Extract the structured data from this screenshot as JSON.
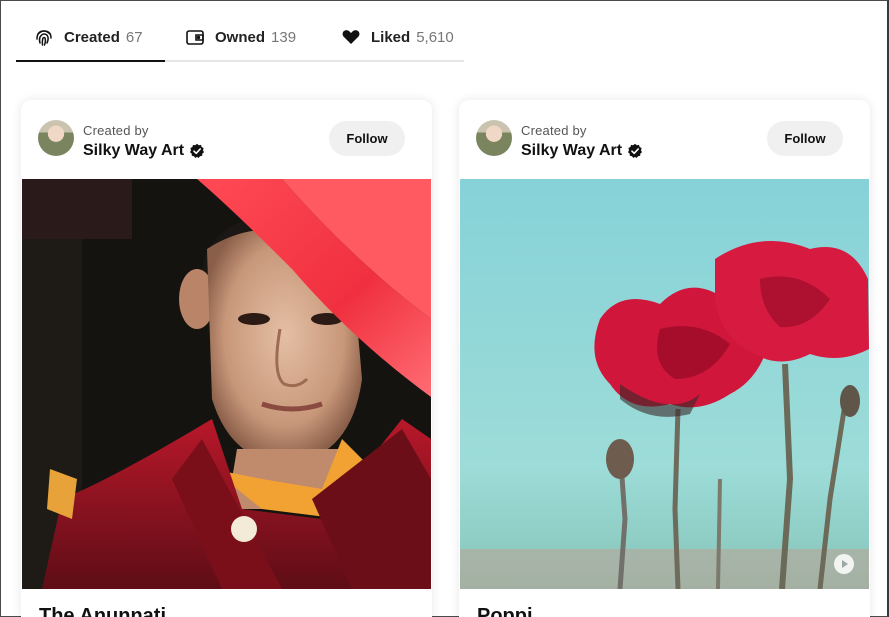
{
  "tabs": [
    {
      "label": "Created",
      "count": "67",
      "icon": "fingerprint-icon",
      "active": true
    },
    {
      "label": "Owned",
      "count": "139",
      "icon": "wallet-icon",
      "active": false
    },
    {
      "label": "Liked",
      "count": "5,610",
      "icon": "heart-icon",
      "active": false
    }
  ],
  "cards": [
    {
      "caption": "Created by",
      "creator": "Silky Way Art",
      "follow_label": "Follow",
      "artwork": "portrait-of-young-monk",
      "title": "The Anunnati..."
    },
    {
      "caption": "Created by",
      "creator": "Silky Way Art",
      "follow_label": "Follow",
      "artwork": "painted-red-poppies",
      "title": "Poppi..."
    }
  ],
  "colors": {
    "active_tab_underline": "#111111",
    "follow_bg": "#f0f0f0",
    "poppy_red": "#d0163b",
    "sky_teal": "#8fd4d6"
  }
}
